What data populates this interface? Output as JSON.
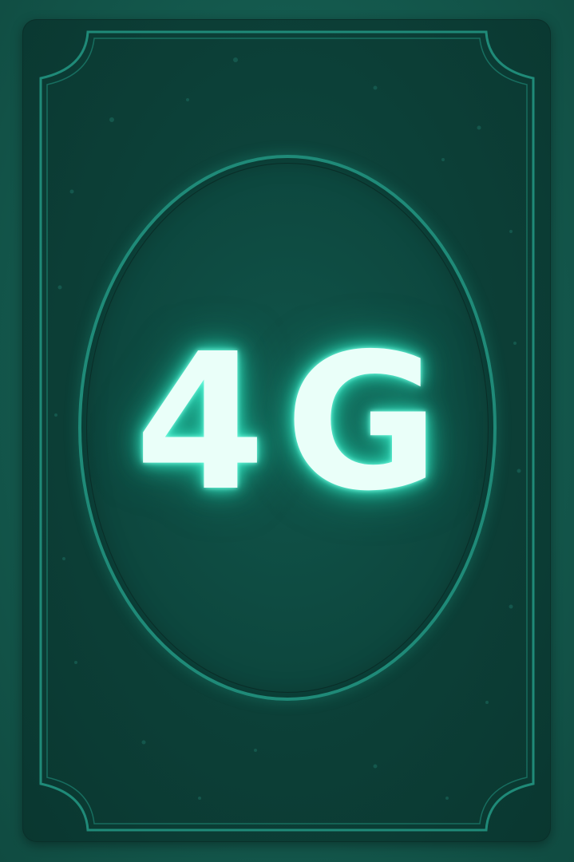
{
  "card": {
    "value_text": "4G"
  },
  "colors": {
    "background": "#13574c",
    "card_fill": "#0c3f37",
    "frame_line": "#1f8a78",
    "glow": "#3fe7c6",
    "text": "#eafff9"
  }
}
